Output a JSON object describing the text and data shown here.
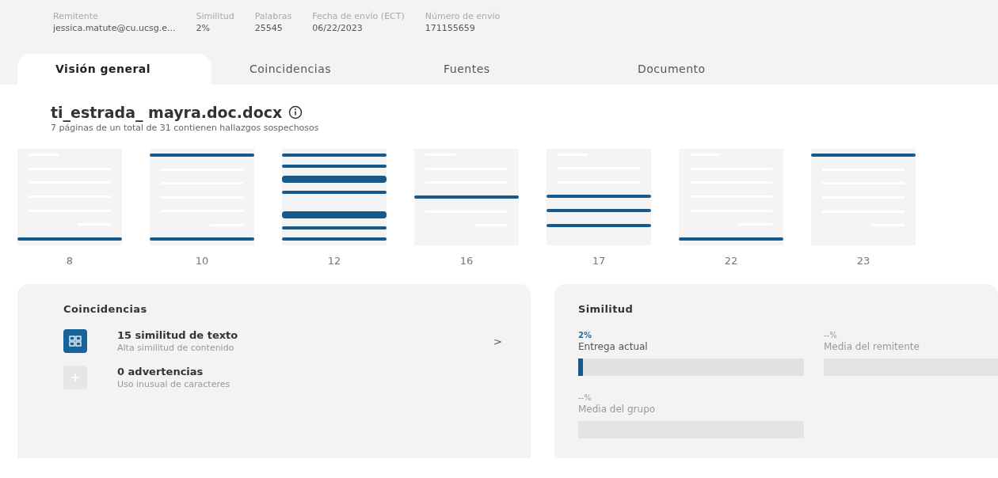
{
  "meta": [
    {
      "label": "Remitente",
      "value": "jessica.matute@cu.ucsg.e..."
    },
    {
      "label": "Similitud",
      "value": "2%"
    },
    {
      "label": "Palabras",
      "value": "25545"
    },
    {
      "label": "Fecha de envío (ECT)",
      "value": "06/22/2023"
    },
    {
      "label": "Número de envío",
      "value": "171155659"
    }
  ],
  "tabs": [
    {
      "label": "Visión general",
      "selected": true
    },
    {
      "label": "Coincidencias",
      "selected": false
    },
    {
      "label": "Fuentes",
      "selected": false
    },
    {
      "label": "Documento",
      "selected": false
    }
  ],
  "document": {
    "title": "ti_estrada_ mayra.doc.docx",
    "subtitle": "7 páginas de un total de 31 contienen hallazgos sospechosos"
  },
  "pages": [
    {
      "number": "8",
      "lines": [
        {
          "kind": "short"
        },
        {
          "kind": "text"
        },
        {
          "kind": "text"
        },
        {
          "kind": "text"
        },
        {
          "kind": "text"
        },
        {
          "kind": "end"
        },
        {
          "kind": "match"
        }
      ]
    },
    {
      "number": "10",
      "lines": [
        {
          "kind": "match"
        },
        {
          "kind": "text"
        },
        {
          "kind": "text"
        },
        {
          "kind": "text"
        },
        {
          "kind": "text"
        },
        {
          "kind": "end"
        },
        {
          "kind": "match"
        }
      ]
    },
    {
      "number": "12",
      "lines": [
        {
          "kind": "match"
        },
        {
          "kind": "match"
        },
        {
          "kind": "thick"
        },
        {
          "kind": "match"
        },
        {
          "kind": "gap"
        },
        {
          "kind": "thick"
        },
        {
          "kind": "match"
        },
        {
          "kind": "match"
        }
      ]
    },
    {
      "number": "16",
      "lines": [
        {
          "kind": "short"
        },
        {
          "kind": "text"
        },
        {
          "kind": "text"
        },
        {
          "kind": "match"
        },
        {
          "kind": "text"
        },
        {
          "kind": "end"
        },
        {
          "kind": "gap"
        }
      ]
    },
    {
      "number": "17",
      "lines": [
        {
          "kind": "short"
        },
        {
          "kind": "text"
        },
        {
          "kind": "text"
        },
        {
          "kind": "match"
        },
        {
          "kind": "match"
        },
        {
          "kind": "match"
        },
        {
          "kind": "gap"
        }
      ]
    },
    {
      "number": "22",
      "lines": [
        {
          "kind": "short"
        },
        {
          "kind": "text"
        },
        {
          "kind": "text"
        },
        {
          "kind": "text"
        },
        {
          "kind": "text"
        },
        {
          "kind": "end"
        },
        {
          "kind": "match"
        }
      ]
    },
    {
      "number": "23",
      "lines": [
        {
          "kind": "match"
        },
        {
          "kind": "text"
        },
        {
          "kind": "text"
        },
        {
          "kind": "text"
        },
        {
          "kind": "text"
        },
        {
          "kind": "end"
        },
        {
          "kind": "gap"
        }
      ]
    }
  ],
  "matches_card": {
    "title": "Coincidencias",
    "items": [
      {
        "kind": "similarity",
        "title": "15 similitud de texto",
        "subtitle": "Alta similitud de contenido",
        "active": true,
        "chevron": ">"
      },
      {
        "kind": "warnings",
        "title": "0 advertencias",
        "subtitle": "Uso inusual de caracteres",
        "active": false
      }
    ]
  },
  "similarity_card": {
    "title": "Similitud",
    "metrics": [
      {
        "value": "2%",
        "label": "Entrega actual",
        "available": true,
        "level": 0.02
      },
      {
        "value": "--%",
        "label": "Media del remitente",
        "available": false
      },
      {
        "value": "--%",
        "label": "Media del grupo",
        "available": false
      }
    ]
  }
}
